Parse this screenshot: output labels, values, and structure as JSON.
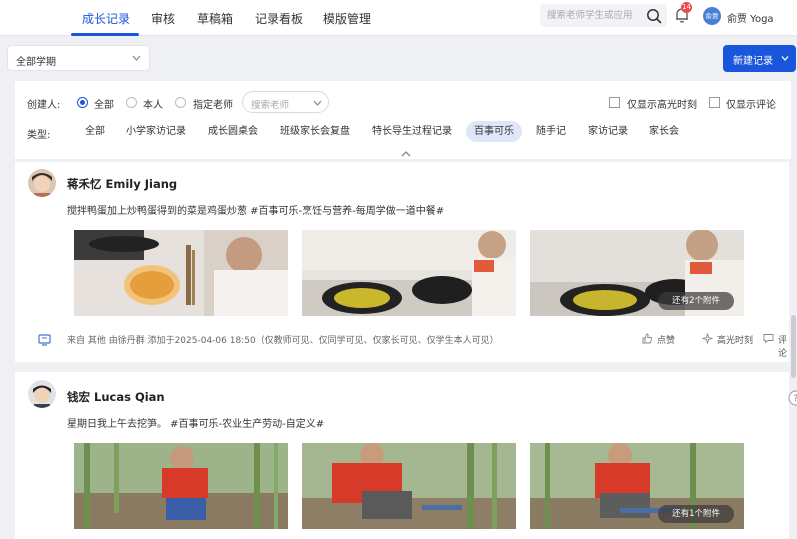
{
  "nav": {
    "tabs": [
      "成长记录",
      "审核",
      "草稿箱",
      "记录看板",
      "模版管理"
    ],
    "search_placeholder": "搜索老师学生或应用",
    "notification_count": "14",
    "user_avatar_text": "俞贾",
    "user_name": "俞贾 Yoga"
  },
  "toolbar": {
    "term_select": "全部学期",
    "new_record_label": "新建记录"
  },
  "filters": {
    "creator_label": "创建人:",
    "creator_options": [
      "全部",
      "本人",
      "指定老师"
    ],
    "teacher_search_placeholder": "搜索老师",
    "only_highlights": "仅显示高光时刻",
    "only_comments": "仅显示评论",
    "type_label": "类型:",
    "types": [
      "全部",
      "小学家访记录",
      "成长圆桌会",
      "班级家长会复盘",
      "特长导生过程记录",
      "百事可乐",
      "随手记",
      "家访记录",
      "家长会"
    ],
    "active_type": "百事可乐"
  },
  "records": [
    {
      "student": "蒋禾忆 Emily Jiang",
      "content": "搅拌鸭蛋加上炒鸭蛋得到的菜是鸡蛋炒葱 #百事可乐-烹饪与营养-每周学做一道中餐#",
      "more_attachments": "还有2个附件",
      "meta": "来自 其他 由徐丹群 添加于2025-04-06 18:50（仅教师可见、仅同学可见、仅家长可见、仅学生本人可见）",
      "actions": [
        "点赞",
        "高光时刻",
        "评论"
      ]
    },
    {
      "student": "钱宏 Lucas Qian",
      "content": "星期日我上午去挖笋。 #百事可乐-农业生产劳动-自定义#",
      "more_attachments": "还有1个附件"
    }
  ],
  "colors": {
    "accent": "#1a56db",
    "badge": "#f04848"
  }
}
